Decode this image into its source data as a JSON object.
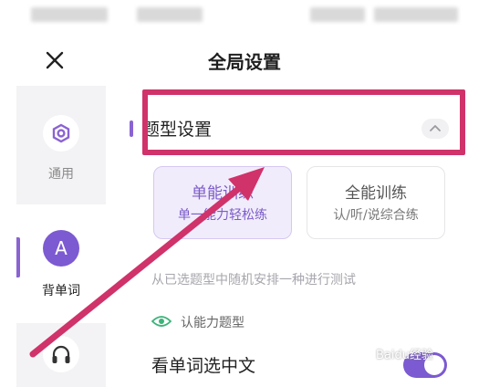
{
  "header": {
    "title": "全局设置"
  },
  "sidebar": {
    "items": [
      {
        "id": "general",
        "label": "通用",
        "icon": "gear-hexagon-icon"
      },
      {
        "id": "words",
        "label": "背单词",
        "icon": "letter-a-icon",
        "icon_text": "A"
      },
      {
        "id": "listen",
        "label": "",
        "icon": "headphones-icon"
      }
    ]
  },
  "section": {
    "title": "题型设置",
    "collapse_icon": "chevron-up-icon"
  },
  "modes": {
    "single": {
      "name": "单能训练",
      "desc": "单一能力轻松练"
    },
    "full": {
      "name": "全能训练",
      "desc": "认/听/说综合练"
    }
  },
  "hint": "从已选题型中随机安排一种进行测试",
  "ability": {
    "label": "认能力题型",
    "icon": "eye-icon"
  },
  "question": {
    "label": "看单词选中文",
    "toggle_on": true
  },
  "colors": {
    "accent": "#8a63d2",
    "annotation": "#d0326a"
  },
  "watermark": "Baidu经验"
}
